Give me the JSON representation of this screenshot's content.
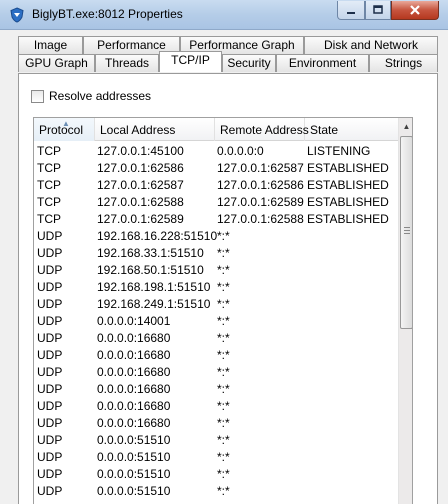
{
  "window": {
    "title": "BiglyBT.exe:8012 Properties"
  },
  "tabs_row1": [
    {
      "label": "Image"
    },
    {
      "label": "Performance"
    },
    {
      "label": "Performance Graph"
    },
    {
      "label": "Disk and Network"
    }
  ],
  "tabs_row2": [
    {
      "label": "GPU Graph"
    },
    {
      "label": "Threads"
    },
    {
      "label": "TCP/IP",
      "active": true
    },
    {
      "label": "Security"
    },
    {
      "label": "Environment"
    },
    {
      "label": "Strings"
    }
  ],
  "options": {
    "resolve_label": "Resolve addresses",
    "resolve_checked": false
  },
  "table": {
    "columns": [
      "Protocol",
      "Local Address",
      "Remote Address",
      "State"
    ],
    "rows": [
      [
        "TCP",
        "127.0.0.1:45100",
        "0.0.0.0:0",
        "LISTENING"
      ],
      [
        "TCP",
        "127.0.0.1:62586",
        "127.0.0.1:62587",
        "ESTABLISHED"
      ],
      [
        "TCP",
        "127.0.0.1:62587",
        "127.0.0.1:62586",
        "ESTABLISHED"
      ],
      [
        "TCP",
        "127.0.0.1:62588",
        "127.0.0.1:62589",
        "ESTABLISHED"
      ],
      [
        "TCP",
        "127.0.0.1:62589",
        "127.0.0.1:62588",
        "ESTABLISHED"
      ],
      [
        "UDP",
        "192.168.16.228:51510",
        "*:*",
        ""
      ],
      [
        "UDP",
        "192.168.33.1:51510",
        "*:*",
        ""
      ],
      [
        "UDP",
        "192.168.50.1:51510",
        "*:*",
        ""
      ],
      [
        "UDP",
        "192.168.198.1:51510",
        "*:*",
        ""
      ],
      [
        "UDP",
        "192.168.249.1:51510",
        "*:*",
        ""
      ],
      [
        "UDP",
        "0.0.0.0:14001",
        "*:*",
        ""
      ],
      [
        "UDP",
        "0.0.0.0:16680",
        "*:*",
        ""
      ],
      [
        "UDP",
        "0.0.0.0:16680",
        "*:*",
        ""
      ],
      [
        "UDP",
        "0.0.0.0:16680",
        "*:*",
        ""
      ],
      [
        "UDP",
        "0.0.0.0:16680",
        "*:*",
        ""
      ],
      [
        "UDP",
        "0.0.0.0:16680",
        "*:*",
        ""
      ],
      [
        "UDP",
        "0.0.0.0:16680",
        "*:*",
        ""
      ],
      [
        "UDP",
        "0.0.0.0:51510",
        "*:*",
        ""
      ],
      [
        "UDP",
        "0.0.0.0:51510",
        "*:*",
        ""
      ],
      [
        "UDP",
        "0.0.0.0:51510",
        "*:*",
        ""
      ],
      [
        "UDP",
        "0.0.0.0:51510",
        "*:*",
        ""
      ]
    ]
  },
  "icons": {
    "app": "shield-app-icon",
    "sort": "sort-ascending-icon",
    "scroll_up": "scroll-up-arrow-icon",
    "scroll_down": "scroll-down-arrow-icon"
  },
  "colors": {
    "title_bar": "#b5cde8",
    "close_button": "#c7553f",
    "panel": "#ffffff"
  }
}
